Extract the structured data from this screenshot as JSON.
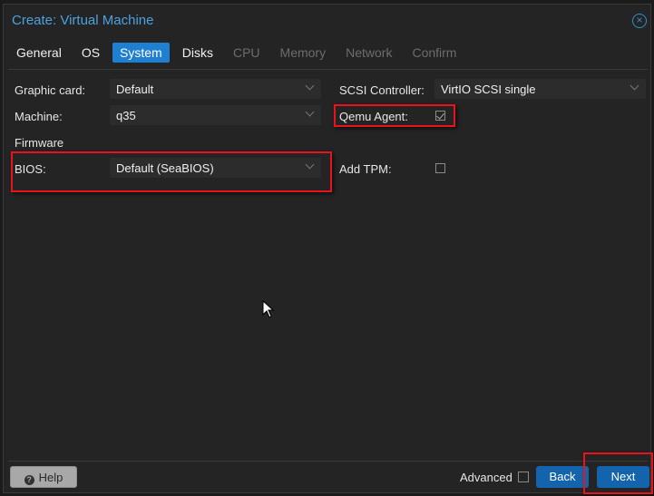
{
  "dialog": {
    "title": "Create: Virtual Machine",
    "close_icon": "close-circle-icon"
  },
  "tabs": [
    {
      "label": "General",
      "state": "enabled"
    },
    {
      "label": "OS",
      "state": "enabled"
    },
    {
      "label": "System",
      "state": "active"
    },
    {
      "label": "Disks",
      "state": "enabled"
    },
    {
      "label": "CPU",
      "state": "disabled"
    },
    {
      "label": "Memory",
      "state": "disabled"
    },
    {
      "label": "Network",
      "state": "disabled"
    },
    {
      "label": "Confirm",
      "state": "disabled"
    }
  ],
  "form": {
    "graphic_card": {
      "label": "Graphic card:",
      "value": "Default"
    },
    "machine": {
      "label": "Machine:",
      "value": "q35"
    },
    "firmware_heading": "Firmware",
    "bios": {
      "label": "BIOS:",
      "value": "Default (SeaBIOS)"
    },
    "scsi_controller": {
      "label": "SCSI Controller:",
      "value": "VirtIO SCSI single"
    },
    "qemu_agent": {
      "label": "Qemu Agent:",
      "checked": true
    },
    "add_tpm": {
      "label": "Add TPM:",
      "checked": false
    }
  },
  "footer": {
    "help_label": "Help",
    "advanced_label": "Advanced",
    "advanced_checked": false,
    "back_label": "Back",
    "next_label": "Next"
  },
  "colors": {
    "accent": "#1f7fd0",
    "title": "#4aa3e0",
    "highlight": "#e8141c",
    "button": "#1464ad"
  }
}
